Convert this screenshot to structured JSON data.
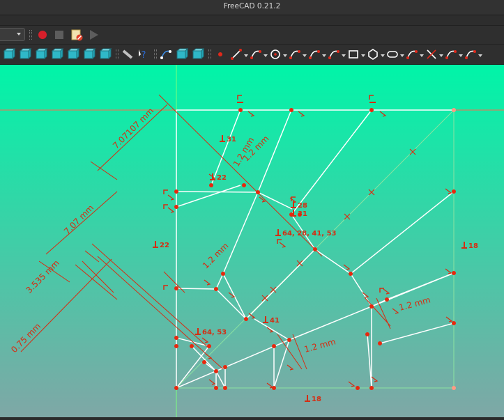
{
  "app": {
    "title": "FreeCAD 0.21.2"
  },
  "toolbar_macro": {
    "combo_value": "",
    "buttons": [
      {
        "name": "record-macro-button",
        "icon": "record-icon"
      },
      {
        "name": "stop-macro-button",
        "icon": "stop-icon"
      },
      {
        "name": "macros-button",
        "icon": "macro-doc-icon"
      },
      {
        "name": "execute-macro-button",
        "icon": "play-icon"
      }
    ]
  },
  "toolbar_sketcher": {
    "groups": [
      [
        "view-fit-icon",
        "view-front-icon",
        "view-top-icon",
        "view-right-icon",
        "view-rear-icon",
        "view-bottom-icon",
        "view-left-icon"
      ],
      [
        "measure-icon",
        "whats-this-icon"
      ],
      [
        "leave-sketch-icon",
        "view-sketch-icon",
        "view-section-icon"
      ],
      [
        "point-icon",
        "line-icon",
        "arc-icon",
        "circle-icon",
        "conic-icon",
        "bspline-icon",
        "polyline-icon",
        "rectangle-icon",
        "polygon-icon",
        "slot-icon",
        "fillet-icon",
        "trim-icon",
        "extend-icon",
        "external-icon"
      ]
    ]
  },
  "colors": {
    "background_top": "#00f5a8",
    "background_bottom": "#7fa7a6",
    "constraint": "#d52d12",
    "geometry": "#ffffff",
    "vertex": "#e8280e",
    "axis_x": "#ff6a4a",
    "axis_y": "#7dff7d"
  },
  "sketch": {
    "dimensions": [
      "7.07107 mm",
      "7.07 mm",
      "3.535 mm",
      "0.75 mm",
      "1.2 mm",
      "1.2 mm",
      "1.2 mm",
      "1.2 mm",
      "1.2 mm"
    ],
    "constraint_labels": [
      "31",
      "22",
      "28",
      "31",
      "64, 28, 41, 53",
      "22",
      "18",
      "41",
      "64, 53",
      "18"
    ]
  }
}
